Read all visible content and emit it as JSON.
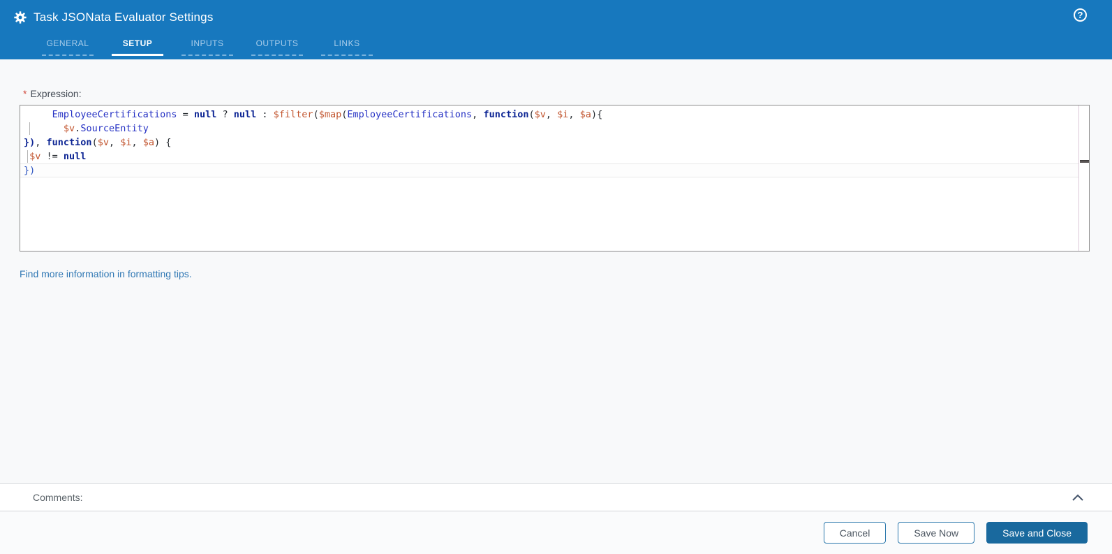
{
  "header": {
    "title": "Task JSONata Evaluator Settings",
    "gear_icon": "gear-icon",
    "help_icon": "circled-question-mark-icon",
    "help_glyph": "?",
    "tabs": [
      {
        "label": "GENERAL",
        "active": false
      },
      {
        "label": "SETUP",
        "active": true
      },
      {
        "label": "INPUTS",
        "active": false
      },
      {
        "label": "OUTPUTS",
        "active": false
      },
      {
        "label": "LINKS",
        "active": false
      }
    ]
  },
  "expression": {
    "label": "Expression:",
    "required": true,
    "required_marker": "*",
    "value": "     EmployeeCertifications = null ? null : $filter($map(EmployeeCertifications, function($v, $i, $a){\n       $v.SourceEntity\n}), function($v, $i, $a) {\n $v != null\n})",
    "lines": [
      {
        "tokens": [
          {
            "t": "     ",
            "c": "pn"
          },
          {
            "t": "EmployeeCertifications",
            "c": "id"
          },
          {
            "t": " = ",
            "c": "pn"
          },
          {
            "t": "null",
            "c": "kw"
          },
          {
            "t": " ? ",
            "c": "pn"
          },
          {
            "t": "null",
            "c": "kw"
          },
          {
            "t": " : ",
            "c": "pn"
          },
          {
            "t": "$filter",
            "c": "var"
          },
          {
            "t": "(",
            "c": "pn"
          },
          {
            "t": "$map",
            "c": "var"
          },
          {
            "t": "(",
            "c": "pn"
          },
          {
            "t": "EmployeeCertifications",
            "c": "id"
          },
          {
            "t": ", ",
            "c": "pn"
          },
          {
            "t": "function",
            "c": "kw"
          },
          {
            "t": "(",
            "c": "pn"
          },
          {
            "t": "$v",
            "c": "var"
          },
          {
            "t": ", ",
            "c": "pn"
          },
          {
            "t": "$i",
            "c": "var"
          },
          {
            "t": ", ",
            "c": "pn"
          },
          {
            "t": "$a",
            "c": "var"
          },
          {
            "t": "){",
            "c": "pn"
          }
        ]
      },
      {
        "guide_ch": 1,
        "tokens": [
          {
            "t": "       ",
            "c": "pn"
          },
          {
            "t": "$v",
            "c": "var"
          },
          {
            "t": ".",
            "c": "pn"
          },
          {
            "t": "SourceEntity",
            "c": "id"
          }
        ]
      },
      {
        "tokens": [
          {
            "t": "})",
            "c": "kw"
          },
          {
            "t": ", ",
            "c": "pn"
          },
          {
            "t": "function",
            "c": "kw"
          },
          {
            "t": "(",
            "c": "pn"
          },
          {
            "t": "$v",
            "c": "var"
          },
          {
            "t": ", ",
            "c": "pn"
          },
          {
            "t": "$i",
            "c": "var"
          },
          {
            "t": ", ",
            "c": "pn"
          },
          {
            "t": "$a",
            "c": "var"
          },
          {
            "t": ") {",
            "c": "pn"
          }
        ]
      },
      {
        "guide_ch": 0.6,
        "tokens": [
          {
            "t": " ",
            "c": "pn"
          },
          {
            "t": "$v",
            "c": "var"
          },
          {
            "t": " != ",
            "c": "pn"
          },
          {
            "t": "null",
            "c": "kw"
          }
        ]
      },
      {
        "active": true,
        "tokens": [
          {
            "t": "})",
            "c": "br2"
          }
        ]
      }
    ]
  },
  "tips_link": {
    "text": "Find more information in formatting tips."
  },
  "comments": {
    "label": "Comments:",
    "collapse_icon": "chevron-up-icon"
  },
  "footer": {
    "buttons": [
      {
        "label": "Cancel",
        "style": "secondary"
      },
      {
        "label": "Save Now",
        "style": "secondary"
      },
      {
        "label": "Save and Close",
        "style": "primary"
      }
    ]
  },
  "colors": {
    "header_bg": "#1778BE",
    "primary_button_bg": "#19699E",
    "secondary_button_border": "#2A77AC",
    "link": "#3078B4",
    "required_marker": "#D04437",
    "code_identifier": "#2531C4",
    "code_keyword": "#0D2594",
    "code_variable": "#C2552F",
    "code_punctuation": "#24292E",
    "editor_border": "#8C8C8C"
  }
}
